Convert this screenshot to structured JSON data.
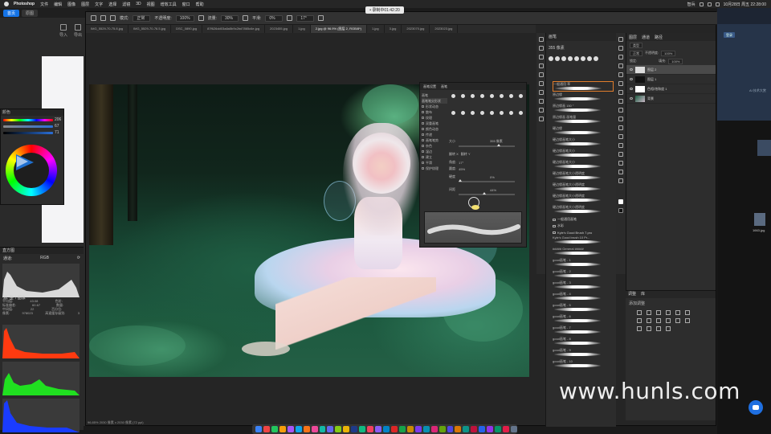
{
  "menubar": {
    "app": "Photoshop",
    "items": [
      "文件",
      "编辑",
      "图像",
      "图层",
      "文字",
      "选择",
      "滤镜",
      "3D",
      "视图",
      "增效工具",
      "窗口",
      "帮助"
    ],
    "clock": "10月28日 周五 22:28:00",
    "user": "智兵"
  },
  "recording": {
    "label": "• 录制中01:42:20"
  },
  "left_app": {
    "tabs": [
      "首页",
      "原图"
    ],
    "tools": [
      "导入",
      "导出"
    ]
  },
  "color_panel": {
    "title": "颜色",
    "values": [
      "206",
      "67",
      "71"
    ]
  },
  "histogram": {
    "title": "直方图",
    "channel_label": "通道:",
    "channel": "RGB",
    "source": "源: 整个图像",
    "stats": [
      [
        "平均值:",
        "43.08",
        "色阶:",
        ""
      ],
      [
        "标准偏差:",
        "60.67",
        "数量:",
        ""
      ],
      [
        "中间值:",
        "22",
        "百分位:",
        ""
      ],
      [
        "像素:",
        "978023",
        "高速缓存级别:",
        "3"
      ]
    ]
  },
  "options_bar": {
    "mode_label": "模式:",
    "mode": "正常",
    "opacity_label": "不透明度:",
    "opacity": "100%",
    "flow_label": "流量:",
    "flow": "30%",
    "smooth_label": "平滑:",
    "smooth": "0%",
    "angle": "17°"
  },
  "tabs": [
    "IMG_5529-70-75.8.jpg",
    "IMG_5529-70-76.5.jpg",
    "DSC_0890.jpg",
    "87f626dd03a8a5b9c2bd7865c6e.jpg",
    "2023455.jpg",
    "1.jpg",
    "2.jpg @ 96.9% (图层 2, RGB/8*)",
    "1.jpg",
    "3.jpg",
    "2023070.jpg",
    "2023023.jpg"
  ],
  "brush_settings": {
    "tabs": [
      "画笔设置",
      "画笔"
    ],
    "left_items": [
      "画笔",
      "画笔笔尖形状",
      "形状动态",
      "散布",
      "纹理",
      "双重画笔",
      "颜色动态",
      "传递",
      "画笔笔势",
      "杂色",
      "湿边",
      "建立",
      "平滑",
      "保护纹理"
    ],
    "size_label": "大小",
    "size": "355 像素",
    "flip_x": "翻转 X",
    "flip_y": "翻转 Y",
    "angle_label": "角度:",
    "angle": "17°",
    "roundness_label": "圆度:",
    "roundness": "45%",
    "hardness_label": "硬度",
    "hardness": "0%",
    "spacing_label": "间距",
    "spacing": "44%"
  },
  "brushes_panel": {
    "title": "画笔",
    "size": "355 像素",
    "items": [
      "一般通用 草",
      "原边缘",
      "原边缘画 150 °",
      "原边缘画 画笔量",
      "硬边缘",
      "硬边缘画笔大小",
      "硬边缘画笔大小",
      "硬边缘画笔大小",
      "硬边缘画笔大小透明度",
      "硬边缘画笔大小透明度",
      "硬边缘画笔大小透明度",
      "硬边缘画笔大小透明度"
    ],
    "folders": [
      "一般通用画笔",
      "水彩",
      "Kyle's Good Brush 7.pro"
    ],
    "items2": [
      "Kyle's Good brush 10 Pr...",
      "##### General #####",
      "good画笔 - 1",
      "good画笔 - 2",
      "good画笔 - 3",
      "good画笔 - 4",
      "good画笔 - 5",
      "good画笔 - 6",
      "good画笔 - 7",
      "good画笔 - 8",
      "good画笔 - 9",
      "good画笔 - 10"
    ]
  },
  "layers": {
    "tabs": [
      "图层",
      "通道",
      "路径"
    ],
    "kind": "类型",
    "blend": "正常",
    "opacity_label": "不透明度:",
    "opacity": "100%",
    "lock_label": "锁定:",
    "fill_label": "填充:",
    "fill": "100%",
    "rows": [
      {
        "name": "图层 2",
        "thumb": "gray"
      },
      {
        "name": "图层 1",
        "thumb": "dark"
      },
      {
        "name": "色相/饱和度 1",
        "thumb": "mask"
      },
      {
        "name": "背景",
        "thumb": "photo"
      }
    ]
  },
  "adjust": {
    "tabs": [
      "调整",
      "库"
    ],
    "sub": "添加调整"
  },
  "right_app": {
    "btn": "登录",
    "side": "AI 技术大赏",
    "filename": "1663.jpg"
  },
  "status": {
    "zoom": "96.85%",
    "doc": "2030 像素 x 2030 像素 (72 ppi)"
  },
  "watermark": "www.hunls.com",
  "dock_colors": [
    "#3b82f6",
    "#ef4444",
    "#22c55e",
    "#f59e0b",
    "#a855f7",
    "#0ea5e9",
    "#f97316",
    "#ec4899",
    "#14b8a6",
    "#6366f1",
    "#84cc16",
    "#eab308",
    "#1e3a8a",
    "#10b981",
    "#f43f5e",
    "#8b5cf6",
    "#0284c7",
    "#dc2626",
    "#16a34a",
    "#ca8a04",
    "#7c3aed",
    "#0891b2",
    "#db2777",
    "#65a30d",
    "#4f46e5",
    "#d97706",
    "#0d9488",
    "#be123c",
    "#2563eb",
    "#9333ea",
    "#059669",
    "#e11d48",
    "#64748b"
  ]
}
